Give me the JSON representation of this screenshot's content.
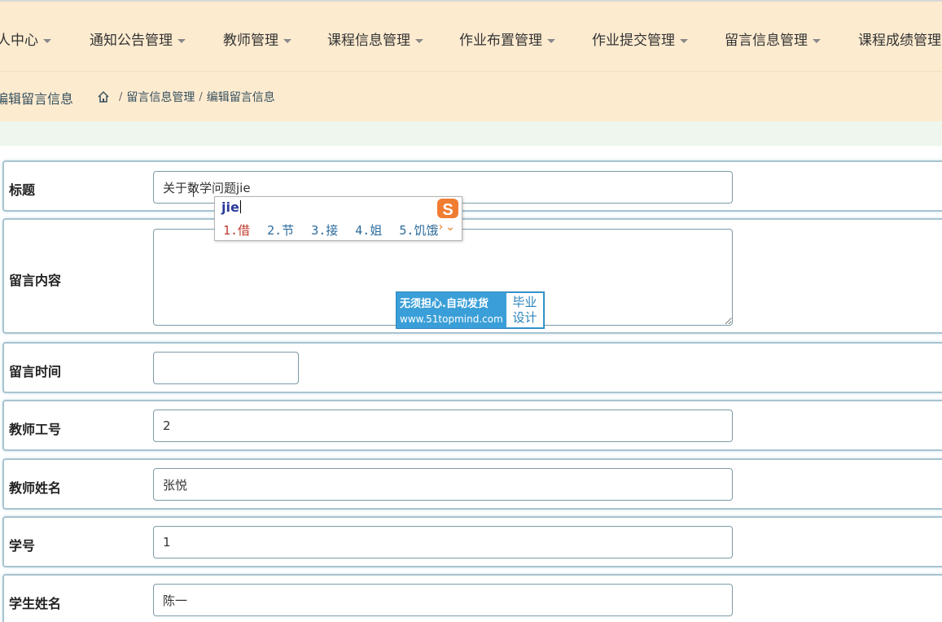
{
  "nav": {
    "items": [
      {
        "label": "人中心"
      },
      {
        "label": "通知公告管理"
      },
      {
        "label": "教师管理"
      },
      {
        "label": "课程信息管理"
      },
      {
        "label": "作业布置管理"
      },
      {
        "label": "作业提交管理"
      },
      {
        "label": "留言信息管理"
      },
      {
        "label": "课程成绩管理"
      }
    ]
  },
  "breadcrumb": {
    "page_title": "编辑留言信息",
    "home_icon": "home-icon",
    "sep": "/",
    "parent": "留言信息管理",
    "current": "编辑留言信息"
  },
  "form": {
    "title": {
      "label": "标题",
      "value": "关于数学问题jie"
    },
    "content": {
      "label": "留言内容",
      "value": ""
    },
    "time": {
      "label": "留言时间",
      "value": ""
    },
    "teacher_id": {
      "label": "教师工号",
      "value": "2"
    },
    "teacher_name": {
      "label": "教师姓名",
      "value": "张悦"
    },
    "student_id": {
      "label": "学号",
      "value": "1"
    },
    "student_name": {
      "label": "学生姓名",
      "value": "陈一"
    }
  },
  "ime": {
    "composition": "jie",
    "candidates": [
      "1.借",
      "2.节",
      "3.接",
      "4.姐",
      "5.饥饿"
    ],
    "logo_icon": "sogou-s-icon",
    "prev_icon": "chevron-left-icon",
    "next_icon": "chevron-right-icon",
    "expand_icon": "chevron-down-icon",
    "colors": {
      "active": "#c0392b",
      "candidate": "#2b6b9c",
      "logo": "#f07c32"
    }
  },
  "watermark": {
    "line1": "无须担心.自动发货",
    "line2": "www.51topmind.com",
    "right1": "毕业",
    "right2": "设计"
  },
  "colors": {
    "nav_bg": "#fdebd0",
    "row_border": "#a7c3cf",
    "watermark_bg": "#3a9fd8"
  }
}
